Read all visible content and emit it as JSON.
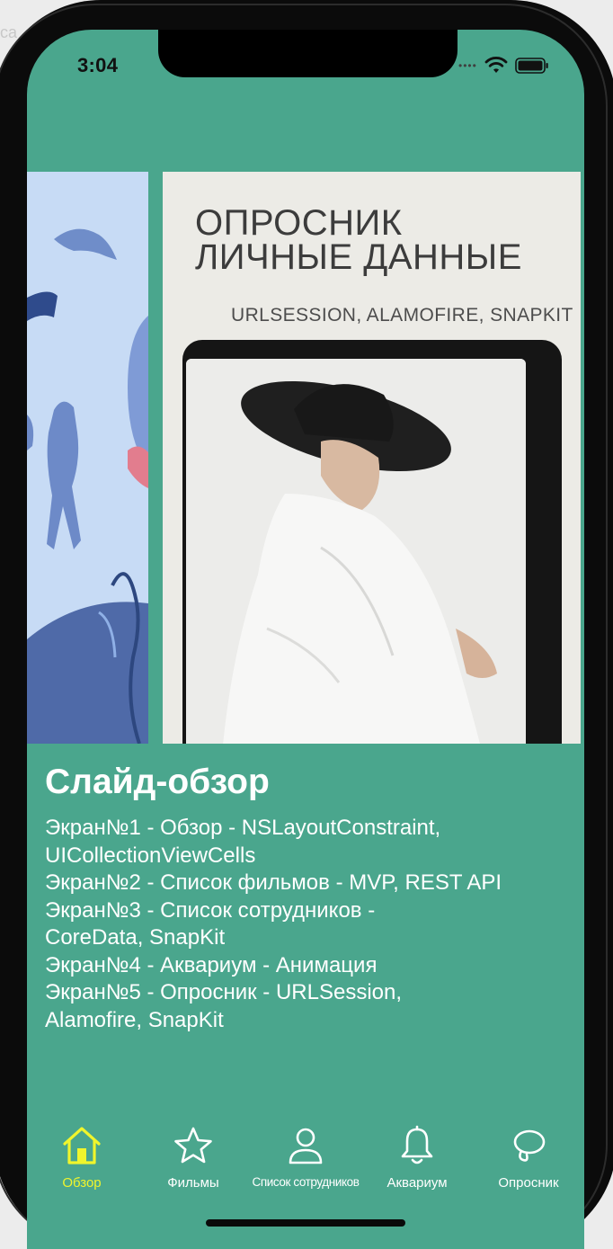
{
  "background_text": "ca",
  "status_bar": {
    "time": "3:04"
  },
  "carousel": {
    "current_slide": {
      "title_line1": "ОПРОСНИК",
      "title_line2": "ЛИЧНЫЕ ДАННЫЕ",
      "subtitle": "URLSESSION, ALAMOFIRE, SNAPKIT"
    }
  },
  "content": {
    "title": "Слайд-обзор",
    "lines": [
      "Экран№1 - Обзор - NSLayoutConstraint,",
      "UICollectionViewCells",
      "Экран№2 - Список фильмов - MVP, REST API",
      "Экран№3 - Список сотрудников -",
      "CoreData, SnapKit",
      "Экран№4 - Аквариум - Анимация",
      "Экран№5 - Опросник - URLSession,",
      "Alamofire, SnapKit"
    ]
  },
  "tabbar": {
    "tabs": [
      {
        "label": "Обзор",
        "icon": "house-icon",
        "active": true
      },
      {
        "label": "Фильмы",
        "icon": "star-icon",
        "active": false
      },
      {
        "label": "Список сотрудников",
        "icon": "person-icon",
        "active": false
      },
      {
        "label": "Аквариум",
        "icon": "bell-icon",
        "active": false
      },
      {
        "label": "Опросник",
        "icon": "lasso-icon",
        "active": false
      }
    ]
  },
  "colors": {
    "screen_background": "#4aa68d",
    "active_tab": "#f0f52c",
    "inactive_tab": "#ffffff",
    "text": "#ffffff"
  }
}
